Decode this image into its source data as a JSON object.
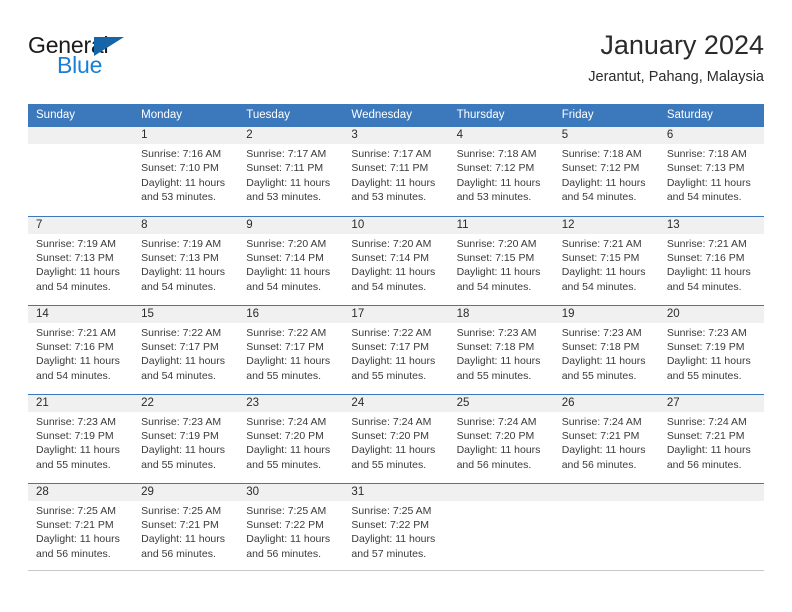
{
  "brand": {
    "name_part1": "General",
    "name_part2": "Blue"
  },
  "header": {
    "title": "January 2024",
    "subtitle": "Jerantut, Pahang, Malaysia"
  },
  "weekdays": [
    "Sunday",
    "Monday",
    "Tuesday",
    "Wednesday",
    "Thursday",
    "Friday",
    "Saturday"
  ],
  "colors": {
    "header_blue": "#3c78bc",
    "logo_blue": "#1b7fd4",
    "daynum_band": "#f0f0f0",
    "text": "#3a3a3a"
  },
  "weeks": [
    [
      {
        "day": "",
        "empty": true
      },
      {
        "day": "1",
        "sunrise": "Sunrise: 7:16 AM",
        "sunset": "Sunset: 7:10 PM",
        "daylight_line1": "Daylight: 11 hours",
        "daylight_line2": "and 53 minutes."
      },
      {
        "day": "2",
        "sunrise": "Sunrise: 7:17 AM",
        "sunset": "Sunset: 7:11 PM",
        "daylight_line1": "Daylight: 11 hours",
        "daylight_line2": "and 53 minutes."
      },
      {
        "day": "3",
        "sunrise": "Sunrise: 7:17 AM",
        "sunset": "Sunset: 7:11 PM",
        "daylight_line1": "Daylight: 11 hours",
        "daylight_line2": "and 53 minutes."
      },
      {
        "day": "4",
        "sunrise": "Sunrise: 7:18 AM",
        "sunset": "Sunset: 7:12 PM",
        "daylight_line1": "Daylight: 11 hours",
        "daylight_line2": "and 53 minutes."
      },
      {
        "day": "5",
        "sunrise": "Sunrise: 7:18 AM",
        "sunset": "Sunset: 7:12 PM",
        "daylight_line1": "Daylight: 11 hours",
        "daylight_line2": "and 54 minutes."
      },
      {
        "day": "6",
        "sunrise": "Sunrise: 7:18 AM",
        "sunset": "Sunset: 7:13 PM",
        "daylight_line1": "Daylight: 11 hours",
        "daylight_line2": "and 54 minutes."
      }
    ],
    [
      {
        "day": "7",
        "sunrise": "Sunrise: 7:19 AM",
        "sunset": "Sunset: 7:13 PM",
        "daylight_line1": "Daylight: 11 hours",
        "daylight_line2": "and 54 minutes."
      },
      {
        "day": "8",
        "sunrise": "Sunrise: 7:19 AM",
        "sunset": "Sunset: 7:13 PM",
        "daylight_line1": "Daylight: 11 hours",
        "daylight_line2": "and 54 minutes."
      },
      {
        "day": "9",
        "sunrise": "Sunrise: 7:20 AM",
        "sunset": "Sunset: 7:14 PM",
        "daylight_line1": "Daylight: 11 hours",
        "daylight_line2": "and 54 minutes."
      },
      {
        "day": "10",
        "sunrise": "Sunrise: 7:20 AM",
        "sunset": "Sunset: 7:14 PM",
        "daylight_line1": "Daylight: 11 hours",
        "daylight_line2": "and 54 minutes."
      },
      {
        "day": "11",
        "sunrise": "Sunrise: 7:20 AM",
        "sunset": "Sunset: 7:15 PM",
        "daylight_line1": "Daylight: 11 hours",
        "daylight_line2": "and 54 minutes."
      },
      {
        "day": "12",
        "sunrise": "Sunrise: 7:21 AM",
        "sunset": "Sunset: 7:15 PM",
        "daylight_line1": "Daylight: 11 hours",
        "daylight_line2": "and 54 minutes."
      },
      {
        "day": "13",
        "sunrise": "Sunrise: 7:21 AM",
        "sunset": "Sunset: 7:16 PM",
        "daylight_line1": "Daylight: 11 hours",
        "daylight_line2": "and 54 minutes."
      }
    ],
    [
      {
        "day": "14",
        "sunrise": "Sunrise: 7:21 AM",
        "sunset": "Sunset: 7:16 PM",
        "daylight_line1": "Daylight: 11 hours",
        "daylight_line2": "and 54 minutes."
      },
      {
        "day": "15",
        "sunrise": "Sunrise: 7:22 AM",
        "sunset": "Sunset: 7:17 PM",
        "daylight_line1": "Daylight: 11 hours",
        "daylight_line2": "and 54 minutes."
      },
      {
        "day": "16",
        "sunrise": "Sunrise: 7:22 AM",
        "sunset": "Sunset: 7:17 PM",
        "daylight_line1": "Daylight: 11 hours",
        "daylight_line2": "and 55 minutes."
      },
      {
        "day": "17",
        "sunrise": "Sunrise: 7:22 AM",
        "sunset": "Sunset: 7:17 PM",
        "daylight_line1": "Daylight: 11 hours",
        "daylight_line2": "and 55 minutes."
      },
      {
        "day": "18",
        "sunrise": "Sunrise: 7:23 AM",
        "sunset": "Sunset: 7:18 PM",
        "daylight_line1": "Daylight: 11 hours",
        "daylight_line2": "and 55 minutes."
      },
      {
        "day": "19",
        "sunrise": "Sunrise: 7:23 AM",
        "sunset": "Sunset: 7:18 PM",
        "daylight_line1": "Daylight: 11 hours",
        "daylight_line2": "and 55 minutes."
      },
      {
        "day": "20",
        "sunrise": "Sunrise: 7:23 AM",
        "sunset": "Sunset: 7:19 PM",
        "daylight_line1": "Daylight: 11 hours",
        "daylight_line2": "and 55 minutes."
      }
    ],
    [
      {
        "day": "21",
        "sunrise": "Sunrise: 7:23 AM",
        "sunset": "Sunset: 7:19 PM",
        "daylight_line1": "Daylight: 11 hours",
        "daylight_line2": "and 55 minutes."
      },
      {
        "day": "22",
        "sunrise": "Sunrise: 7:23 AM",
        "sunset": "Sunset: 7:19 PM",
        "daylight_line1": "Daylight: 11 hours",
        "daylight_line2": "and 55 minutes."
      },
      {
        "day": "23",
        "sunrise": "Sunrise: 7:24 AM",
        "sunset": "Sunset: 7:20 PM",
        "daylight_line1": "Daylight: 11 hours",
        "daylight_line2": "and 55 minutes."
      },
      {
        "day": "24",
        "sunrise": "Sunrise: 7:24 AM",
        "sunset": "Sunset: 7:20 PM",
        "daylight_line1": "Daylight: 11 hours",
        "daylight_line2": "and 55 minutes."
      },
      {
        "day": "25",
        "sunrise": "Sunrise: 7:24 AM",
        "sunset": "Sunset: 7:20 PM",
        "daylight_line1": "Daylight: 11 hours",
        "daylight_line2": "and 56 minutes."
      },
      {
        "day": "26",
        "sunrise": "Sunrise: 7:24 AM",
        "sunset": "Sunset: 7:21 PM",
        "daylight_line1": "Daylight: 11 hours",
        "daylight_line2": "and 56 minutes."
      },
      {
        "day": "27",
        "sunrise": "Sunrise: 7:24 AM",
        "sunset": "Sunset: 7:21 PM",
        "daylight_line1": "Daylight: 11 hours",
        "daylight_line2": "and 56 minutes."
      }
    ],
    [
      {
        "day": "28",
        "sunrise": "Sunrise: 7:25 AM",
        "sunset": "Sunset: 7:21 PM",
        "daylight_line1": "Daylight: 11 hours",
        "daylight_line2": "and 56 minutes."
      },
      {
        "day": "29",
        "sunrise": "Sunrise: 7:25 AM",
        "sunset": "Sunset: 7:21 PM",
        "daylight_line1": "Daylight: 11 hours",
        "daylight_line2": "and 56 minutes."
      },
      {
        "day": "30",
        "sunrise": "Sunrise: 7:25 AM",
        "sunset": "Sunset: 7:22 PM",
        "daylight_line1": "Daylight: 11 hours",
        "daylight_line2": "and 56 minutes."
      },
      {
        "day": "31",
        "sunrise": "Sunrise: 7:25 AM",
        "sunset": "Sunset: 7:22 PM",
        "daylight_line1": "Daylight: 11 hours",
        "daylight_line2": "and 57 minutes."
      },
      {
        "day": "",
        "empty": true
      },
      {
        "day": "",
        "empty": true
      },
      {
        "day": "",
        "empty": true
      }
    ]
  ]
}
